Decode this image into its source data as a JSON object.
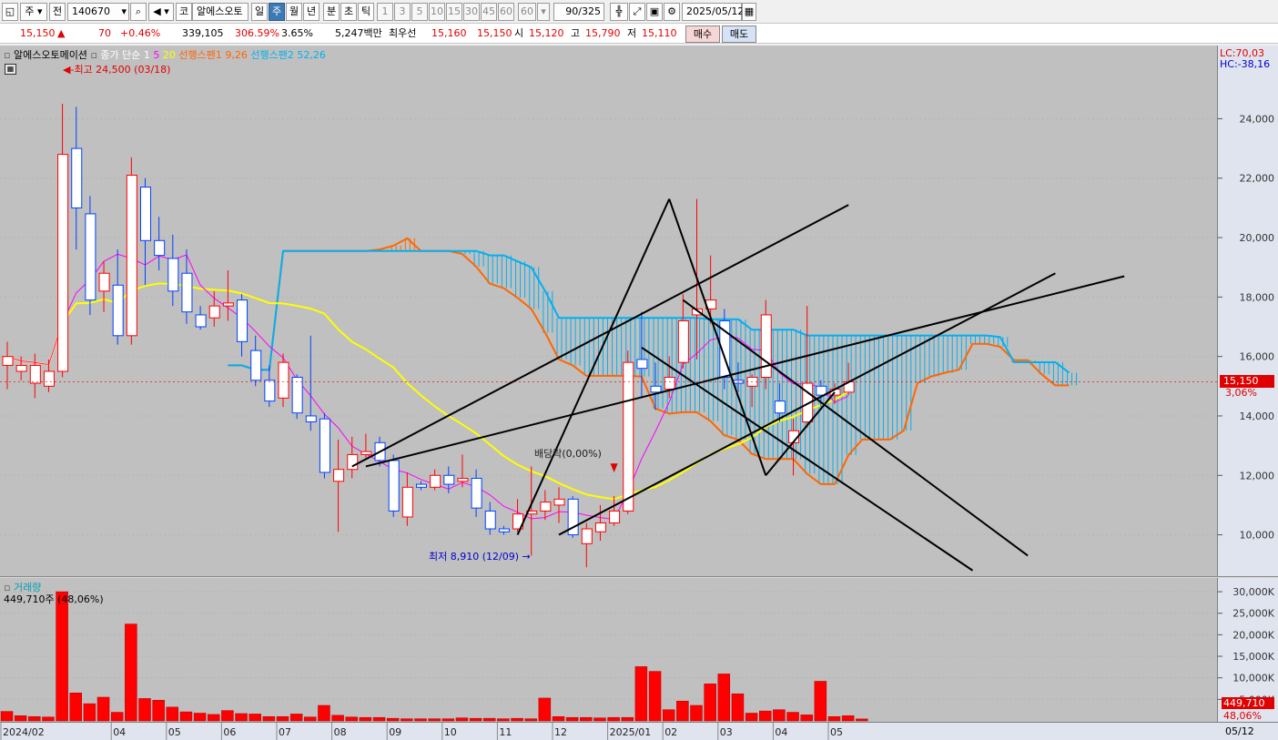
{
  "toolbar": {
    "period_select": "주",
    "prev_label": "전",
    "code": "140670",
    "market_label": "코",
    "name": "알에스오토",
    "tabs": [
      "일",
      "주",
      "월",
      "년",
      "분",
      "초",
      "틱"
    ],
    "active_tab": "주",
    "intervals": [
      "1",
      "3",
      "5",
      "10",
      "15",
      "30",
      "45",
      "60",
      "60"
    ],
    "count": "90/325",
    "date": "2025/05/12"
  },
  "quote": {
    "price": "15,150",
    "arrow": "▲",
    "change": "70",
    "change_pct": "+0.46%",
    "volume": "339,105",
    "vol_ratio": "306.59%",
    "turnover": "3.65%",
    "amount": "5,247백만",
    "pref_label": "최우선",
    "ask": "15,160",
    "bid": "15,150",
    "open_label": "시",
    "open": "15,120",
    "high_label": "고",
    "high": "15,790",
    "low_label": "저",
    "low": "15,110",
    "buy_label": "매수",
    "sell_label": "매도"
  },
  "legend": {
    "name": "알에스오토메이션",
    "ma_label": "종가 단순 1",
    "ma5": "5",
    "ma20": "20",
    "span1": "선행스팬1 9,26",
    "span2": "선행스팬2 52,26",
    "lc": "LC:70,03",
    "hc": "HC:-38,16",
    "high_note": "최고 24,500 (03/18)",
    "low_note": "최저 8,910 (12/09)",
    "dividend_note": "배당락(0,00%)",
    "current_price_tag": "15,150",
    "current_pct_tag": "3,06%",
    "vol_title": "거래량",
    "vol_value": "449,710주 (48,06%)",
    "vol_tag": "449,710",
    "vol_pct_tag": "48,06%"
  },
  "colors": {
    "up": "#ff0000",
    "down": "#0040ff",
    "ma5": "#ff00ff",
    "ma20": "#ffff00",
    "span1": "#ff6600",
    "span2": "#00b0f0",
    "background": "#c0c0c0"
  },
  "chart_data": {
    "type": "candlestick",
    "x_dates": [
      "2024/02",
      "2024/02",
      "2024/02",
      "2024/02",
      "2024/03",
      "2024/03",
      "2024/03",
      "2024/03",
      "2024/04",
      "2024/04",
      "2024/04",
      "2024/04",
      "2024/05",
      "2024/05",
      "2024/05",
      "2024/05",
      "2024/06",
      "2024/06",
      "2024/06",
      "2024/06",
      "2024/07",
      "2024/07",
      "2024/07",
      "2024/07",
      "2024/08",
      "2024/08",
      "2024/08",
      "2024/08",
      "2024/09",
      "2024/09",
      "2024/09",
      "2024/09",
      "2024/10",
      "2024/10",
      "2024/10",
      "2024/10",
      "2024/11",
      "2024/11",
      "2024/11",
      "2024/11",
      "2024/12",
      "2024/12",
      "2024/12",
      "2024/12",
      "2025/01",
      "2025/01",
      "2025/01",
      "2025/01",
      "2025/02",
      "2025/02",
      "2025/02",
      "2025/02",
      "2025/03",
      "2025/03",
      "2025/03",
      "2025/03",
      "2025/04",
      "2025/04",
      "2025/04",
      "2025/04",
      "2025/05",
      "2025/05"
    ],
    "x_ticks": [
      "2024/02",
      "04",
      "05",
      "06",
      "07",
      "08",
      "09",
      "10",
      "11",
      "12",
      "2025/01",
      "02",
      "03",
      "04",
      "05"
    ],
    "last_tick": "05/12",
    "candles": [
      {
        "o": 15700,
        "h": 16500,
        "l": 14900,
        "c": 16000
      },
      {
        "o": 15500,
        "h": 16000,
        "l": 15200,
        "c": 15700
      },
      {
        "o": 15100,
        "h": 16100,
        "l": 14600,
        "c": 15700
      },
      {
        "o": 15000,
        "h": 15900,
        "l": 14800,
        "c": 15500
      },
      {
        "o": 15500,
        "h": 24500,
        "l": 15300,
        "c": 22800
      },
      {
        "o": 23000,
        "h": 24400,
        "l": 19600,
        "c": 21000
      },
      {
        "o": 20800,
        "h": 21400,
        "l": 17400,
        "c": 17900
      },
      {
        "o": 18200,
        "h": 19200,
        "l": 17500,
        "c": 18800
      },
      {
        "o": 18400,
        "h": 19600,
        "l": 16400,
        "c": 16700
      },
      {
        "o": 16700,
        "h": 22700,
        "l": 16400,
        "c": 22100
      },
      {
        "o": 21700,
        "h": 22000,
        "l": 18400,
        "c": 19900
      },
      {
        "o": 19900,
        "h": 20700,
        "l": 18900,
        "c": 19400
      },
      {
        "o": 19300,
        "h": 20100,
        "l": 17700,
        "c": 18200
      },
      {
        "o": 18800,
        "h": 19600,
        "l": 17100,
        "c": 17500
      },
      {
        "o": 17400,
        "h": 17700,
        "l": 16900,
        "c": 17000
      },
      {
        "o": 17300,
        "h": 18200,
        "l": 17000,
        "c": 17700
      },
      {
        "o": 17700,
        "h": 18900,
        "l": 17200,
        "c": 17800
      },
      {
        "o": 17900,
        "h": 18100,
        "l": 16000,
        "c": 16500
      },
      {
        "o": 16200,
        "h": 16700,
        "l": 15000,
        "c": 15200
      },
      {
        "o": 15200,
        "h": 15700,
        "l": 14300,
        "c": 14500
      },
      {
        "o": 14600,
        "h": 16100,
        "l": 14300,
        "c": 15800
      },
      {
        "o": 15300,
        "h": 15400,
        "l": 13900,
        "c": 14100
      },
      {
        "o": 14000,
        "h": 16700,
        "l": 13500,
        "c": 13800
      },
      {
        "o": 13900,
        "h": 14100,
        "l": 11900,
        "c": 12100
      },
      {
        "o": 11800,
        "h": 13200,
        "l": 10100,
        "c": 12200
      },
      {
        "o": 12200,
        "h": 13300,
        "l": 11900,
        "c": 12700
      },
      {
        "o": 12700,
        "h": 13400,
        "l": 12600,
        "c": 12800
      },
      {
        "o": 13100,
        "h": 13300,
        "l": 12300,
        "c": 12500
      },
      {
        "o": 12500,
        "h": 12700,
        "l": 10600,
        "c": 10800
      },
      {
        "o": 10600,
        "h": 12100,
        "l": 10300,
        "c": 11600
      },
      {
        "o": 11700,
        "h": 11800,
        "l": 11500,
        "c": 11600
      },
      {
        "o": 11600,
        "h": 12200,
        "l": 11500,
        "c": 12000
      },
      {
        "o": 12000,
        "h": 12300,
        "l": 11400,
        "c": 11700
      },
      {
        "o": 11800,
        "h": 12700,
        "l": 11600,
        "c": 11900
      },
      {
        "o": 11900,
        "h": 12200,
        "l": 10600,
        "c": 10900
      },
      {
        "o": 10800,
        "h": 11100,
        "l": 10000,
        "c": 10200
      },
      {
        "o": 10200,
        "h": 10300,
        "l": 10000,
        "c": 10100
      },
      {
        "o": 10200,
        "h": 11200,
        "l": 10100,
        "c": 10700
      },
      {
        "o": 10700,
        "h": 12300,
        "l": 9300,
        "c": 10800
      },
      {
        "o": 10800,
        "h": 11500,
        "l": 10500,
        "c": 11100
      },
      {
        "o": 11000,
        "h": 11600,
        "l": 10400,
        "c": 11200
      },
      {
        "o": 11200,
        "h": 11300,
        "l": 9900,
        "c": 10000
      },
      {
        "o": 9700,
        "h": 10400,
        "l": 8910,
        "c": 10200
      },
      {
        "o": 10100,
        "h": 11000,
        "l": 9800,
        "c": 10400
      },
      {
        "o": 10400,
        "h": 11300,
        "l": 10300,
        "c": 10800
      },
      {
        "o": 10800,
        "h": 16200,
        "l": 10700,
        "c": 15800
      },
      {
        "o": 15900,
        "h": 17500,
        "l": 14600,
        "c": 15600
      },
      {
        "o": 15000,
        "h": 15800,
        "l": 14200,
        "c": 14800
      },
      {
        "o": 14900,
        "h": 16000,
        "l": 14600,
        "c": 15300
      },
      {
        "o": 15800,
        "h": 18100,
        "l": 15600,
        "c": 17200
      },
      {
        "o": 17400,
        "h": 21300,
        "l": 15900,
        "c": 17600
      },
      {
        "o": 17600,
        "h": 19400,
        "l": 17100,
        "c": 17900
      },
      {
        "o": 17200,
        "h": 17600,
        "l": 14900,
        "c": 15300
      },
      {
        "o": 15200,
        "h": 15800,
        "l": 14800,
        "c": 15100
      },
      {
        "o": 15000,
        "h": 15400,
        "l": 14300,
        "c": 15300
      },
      {
        "o": 15300,
        "h": 17900,
        "l": 14900,
        "c": 17400
      },
      {
        "o": 14500,
        "h": 15100,
        "l": 13800,
        "c": 14100
      },
      {
        "o": 13100,
        "h": 13900,
        "l": 12000,
        "c": 13500
      },
      {
        "o": 13800,
        "h": 17700,
        "l": 13600,
        "c": 15100
      },
      {
        "o": 15000,
        "h": 15200,
        "l": 14300,
        "c": 14700
      },
      {
        "o": 14700,
        "h": 15100,
        "l": 14400,
        "c": 14900
      },
      {
        "o": 14800,
        "h": 15790,
        "l": 14700,
        "c": 15150
      }
    ],
    "volume_k": [
      2200,
      1200,
      1000,
      900,
      30000,
      6500,
      4000,
      5500,
      2000,
      22500,
      5200,
      4800,
      3200,
      2100,
      1800,
      1500,
      2400,
      1700,
      1600,
      1000,
      1000,
      1600,
      900,
      3600,
      1300,
      900,
      800,
      800,
      600,
      500,
      500,
      500,
      500,
      700,
      600,
      600,
      500,
      600,
      500,
      5300,
      1000,
      800,
      800,
      700,
      800,
      800,
      12600,
      11500,
      2600,
      4600,
      3600,
      8600,
      10900,
      6300,
      1800,
      2300,
      2600,
      2000,
      1400,
      9200,
      1000,
      1200,
      450
    ],
    "ylim": [
      8700,
      25300
    ],
    "y_ticks": [
      10000,
      12000,
      14000,
      16000,
      18000,
      20000,
      22000,
      24000
    ],
    "vol_ylim": [
      0,
      31500
    ],
    "vol_ticks": [
      5000,
      10000,
      15000,
      20000,
      25000,
      30000
    ],
    "ma20_visible": true,
    "ichimoku": {
      "span1_text": "선행스팬1 9,26",
      "span2_text": "선행스팬2 52,26"
    }
  }
}
